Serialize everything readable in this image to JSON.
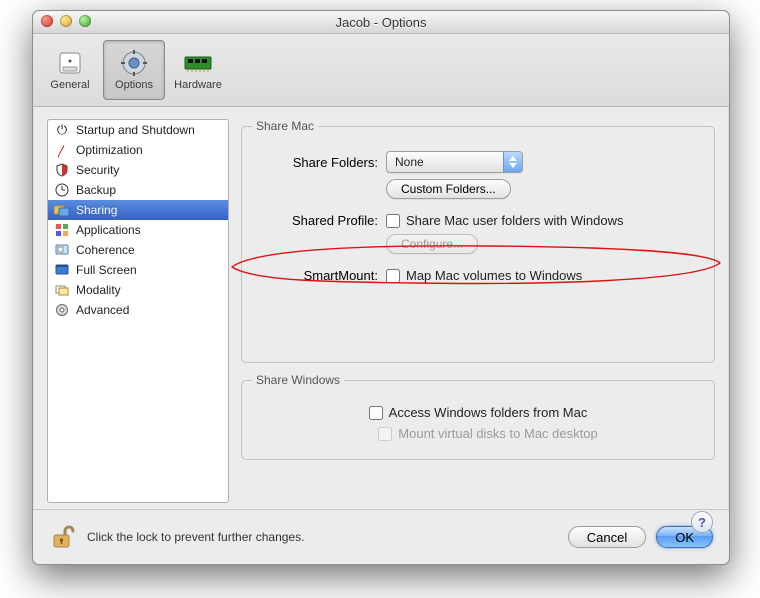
{
  "window": {
    "title": "Jacob - Options"
  },
  "toolbar": {
    "items": [
      {
        "label": "General",
        "selected": false
      },
      {
        "label": "Options",
        "selected": true
      },
      {
        "label": "Hardware",
        "selected": false
      }
    ]
  },
  "sidebar": {
    "items": [
      {
        "label": "Startup and Shutdown",
        "icon": "power-icon",
        "selected": false
      },
      {
        "label": "Optimization",
        "icon": "pulse-icon",
        "selected": false
      },
      {
        "label": "Security",
        "icon": "shield-icon",
        "selected": false
      },
      {
        "label": "Backup",
        "icon": "clock-icon",
        "selected": false
      },
      {
        "label": "Sharing",
        "icon": "folders-icon",
        "selected": true
      },
      {
        "label": "Applications",
        "icon": "apps-icon",
        "selected": false
      },
      {
        "label": "Coherence",
        "icon": "coherence-icon",
        "selected": false
      },
      {
        "label": "Full Screen",
        "icon": "fullscreen-icon",
        "selected": false
      },
      {
        "label": "Modality",
        "icon": "modality-icon",
        "selected": false
      },
      {
        "label": "Advanced",
        "icon": "gear-icon",
        "selected": false
      }
    ]
  },
  "share_mac": {
    "legend": "Share Mac",
    "share_folders_label": "Share Folders:",
    "share_folders_value": "None",
    "custom_folders_label": "Custom Folders...",
    "shared_profile_label": "Shared Profile:",
    "shared_profile_checkbox_label": "Share Mac user folders with Windows",
    "shared_profile_checked": false,
    "configure_label": "Configure...",
    "smartmount_label": "SmartMount:",
    "smartmount_checkbox_label": "Map Mac volumes to Windows",
    "smartmount_checked": false
  },
  "share_windows": {
    "legend": "Share Windows",
    "access_checkbox_label": "Access Windows folders from Mac",
    "access_checked": false,
    "mount_checkbox_label": "Mount virtual disks to Mac desktop",
    "mount_checked": false,
    "mount_disabled": true
  },
  "footer": {
    "lock_msg": "Click the lock to prevent further changes.",
    "cancel_label": "Cancel",
    "ok_label": "OK"
  },
  "help": {
    "label": "?"
  }
}
